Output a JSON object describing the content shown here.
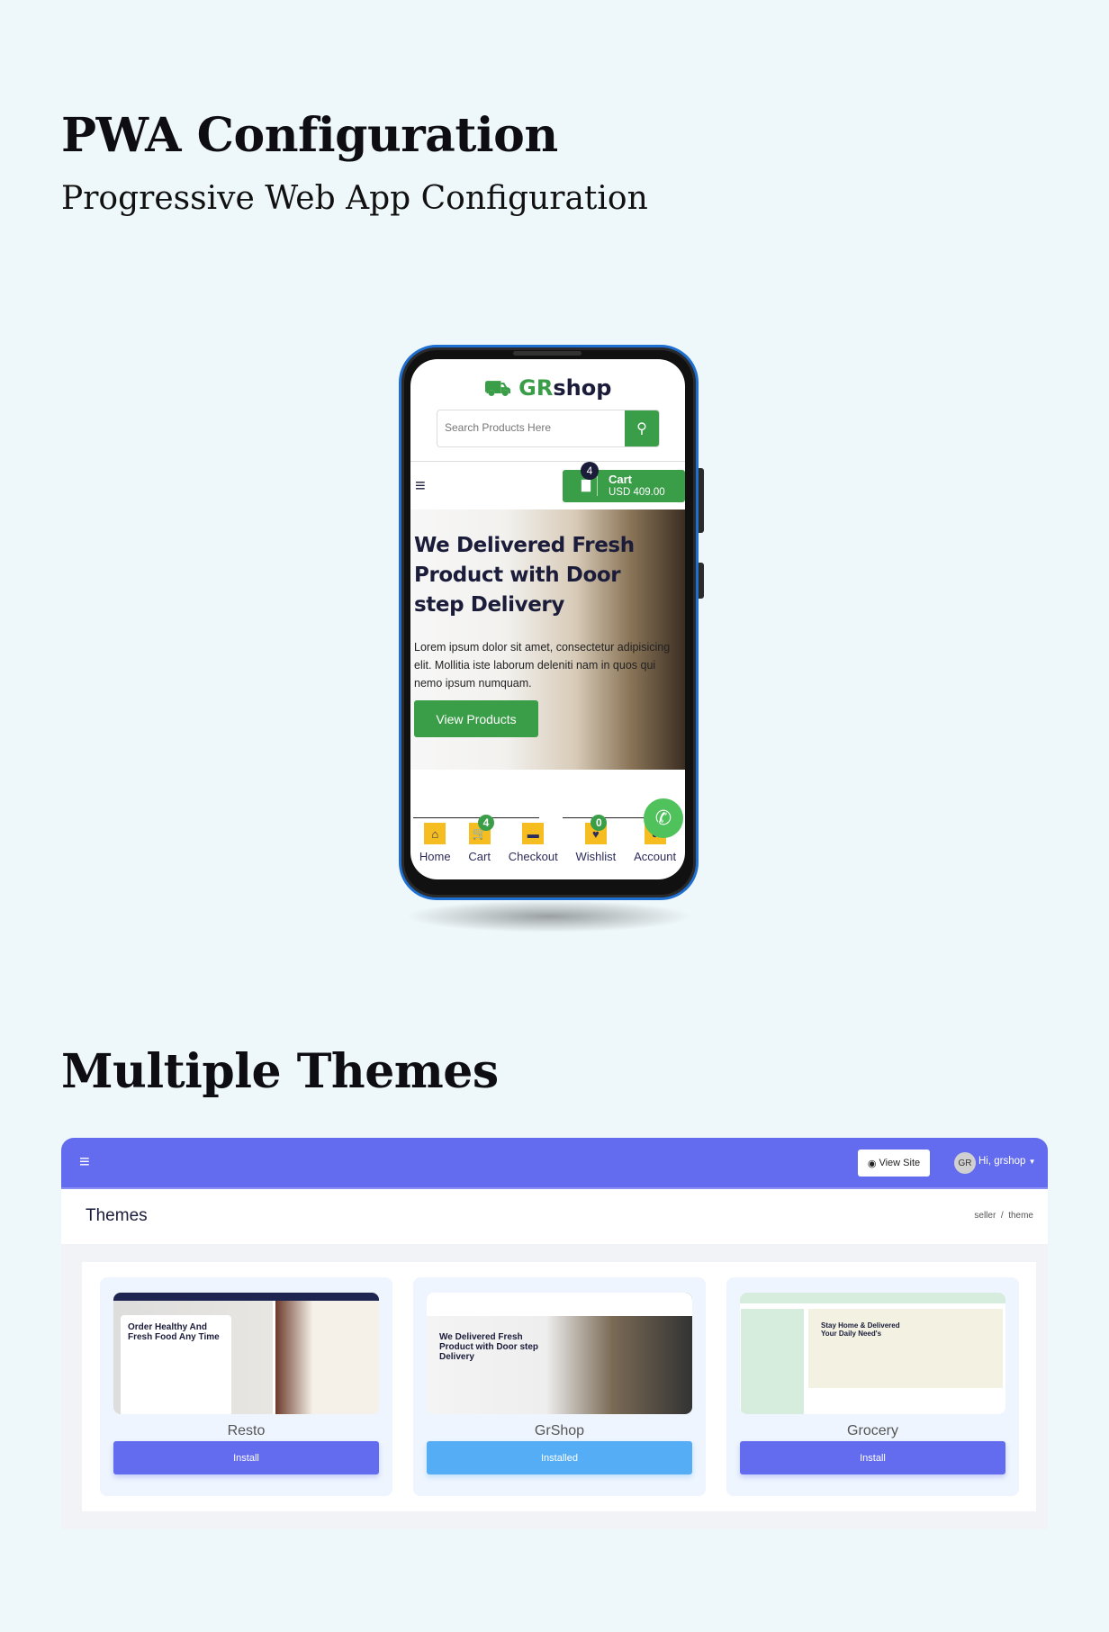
{
  "header": {
    "title": "PWA Configuration",
    "subtitle": "Progressive Web App Configuration"
  },
  "phone": {
    "logo": {
      "part1": "GR",
      "part2": "shop"
    },
    "search": {
      "placeholder": "Search Products Here",
      "icon": "search-icon"
    },
    "cart": {
      "count": "4",
      "label": "Cart",
      "total": "USD 409.00"
    },
    "hero": {
      "heading": "We Delivered Fresh Product with Door step Delivery",
      "text": "Lorem ipsum dolor sit amet, consectetur adipisicing elit. Mollitia iste laborum deleniti nam in quos qui nemo ipsum numquam.",
      "button": "View Products"
    },
    "bottom_nav": [
      {
        "label": "Home",
        "icon": "home-icon"
      },
      {
        "label": "Cart",
        "icon": "cart-icon",
        "badge": "4"
      },
      {
        "label": "Checkout",
        "icon": "credit-card-icon"
      },
      {
        "label": "Wishlist",
        "icon": "heart-icon",
        "badge": "0"
      },
      {
        "label": "Account",
        "icon": "user-icon"
      }
    ]
  },
  "themes_section": {
    "title": "Multiple Themes"
  },
  "admin": {
    "view_site": "View Site",
    "avatar": "GR",
    "user": "Hi, grshop",
    "page_title": "Themes",
    "breadcrumb": [
      "seller",
      "theme"
    ],
    "themes": [
      {
        "name": "Resto",
        "button": "Install",
        "preview_heading": "Order Healthy And Fresh Food Any Time"
      },
      {
        "name": "GrShop",
        "button": "Installed",
        "preview_heading": "We Delivered Fresh Product with Door step Delivery"
      },
      {
        "name": "Grocery",
        "button": "Install",
        "preview_heading": "Stay Home & Delivered Your Daily Need's"
      }
    ]
  },
  "colors": {
    "green": "#3a9d48",
    "indigo": "#636cee",
    "installed": "#55aef5",
    "yellow": "#f5bd1f",
    "navy": "#1a1c3a"
  }
}
